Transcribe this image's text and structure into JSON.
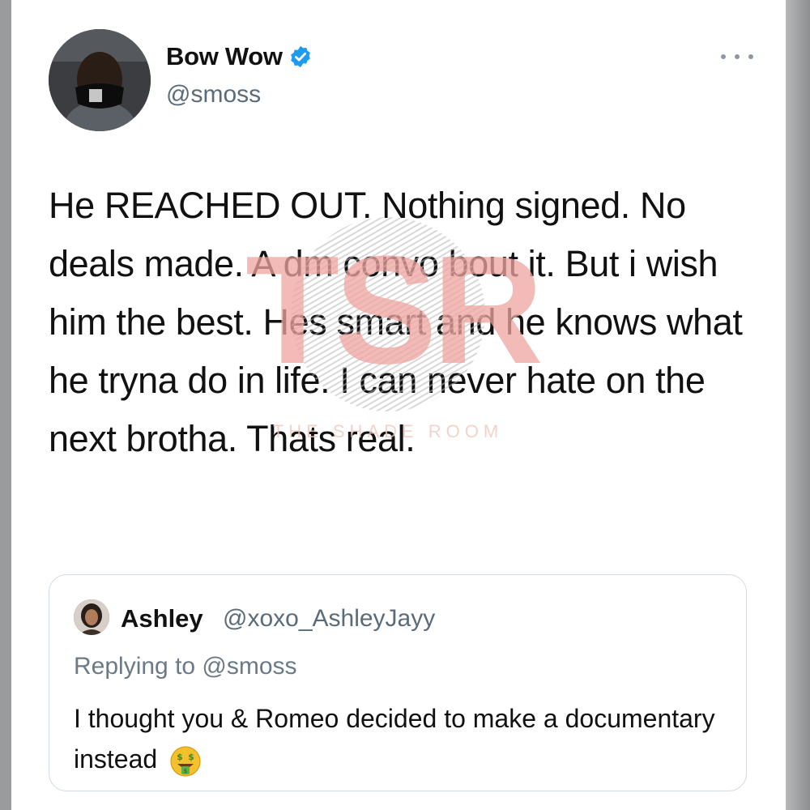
{
  "tweet": {
    "author_name": "Bow Wow",
    "author_handle": "@smoss",
    "text": "He REACHED OUT. Nothing signed. No deals made. A dm convo bout it. But i wish him the best. Hes smart and he knows what he tryna do in life. I can never hate on the next brotha. Thats real.",
    "verified_icon": "verified-badge-icon",
    "more_icon": "more-options-icon"
  },
  "watermark": {
    "logo": "TSR",
    "tagline": "THE SHADE ROOM"
  },
  "quoted_tweet": {
    "author_name": "Ashley",
    "author_handle": "@xoxo_AshleyJayy",
    "replying_to": "Replying to @smoss",
    "text": "I thought you & Romeo decided to make a documentary instead",
    "emoji": "money-mouth-face-icon"
  },
  "colors": {
    "verified_blue": "#1d9bf0",
    "watermark_pink": "#f0a5a0",
    "secondary_text": "#5b6b78"
  }
}
